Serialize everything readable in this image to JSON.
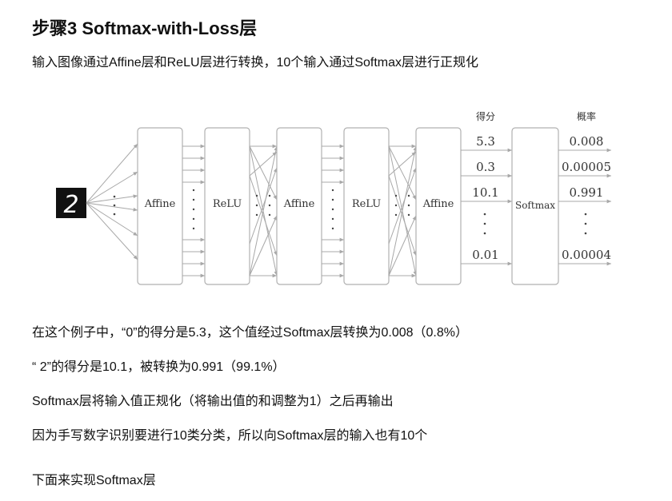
{
  "heading": "步骤3 Softmax-with-Loss层",
  "intro": "输入图像通过Affine层和ReLU层进行转换，10个输入通过Softmax层进行正规化",
  "diagram": {
    "input_digit": "2",
    "layers": [
      "Affine",
      "ReLU",
      "Affine",
      "ReLU",
      "Affine"
    ],
    "softmax_label": "Softmax",
    "score_header": "得分",
    "prob_header": "概率",
    "scores": [
      "5.3",
      "0.3",
      "10.1",
      "0.01"
    ],
    "probs": [
      "0.008",
      "0.00005",
      "0.991",
      "0.00004"
    ]
  },
  "paragraphs": [
    "在这个例子中，“0”的得分是5.3，这个值经过Softmax层转换为0.008（0.8%）",
    "“ 2”的得分是10.1，被转换为0.991（99.1%）",
    "Softmax层将输入值正规化（将输出值的和调整为1）之后再输出",
    "因为手写数字识别要进行10类分类，所以向Softmax层的输入也有10个",
    "下面来实现Softmax层"
  ]
}
